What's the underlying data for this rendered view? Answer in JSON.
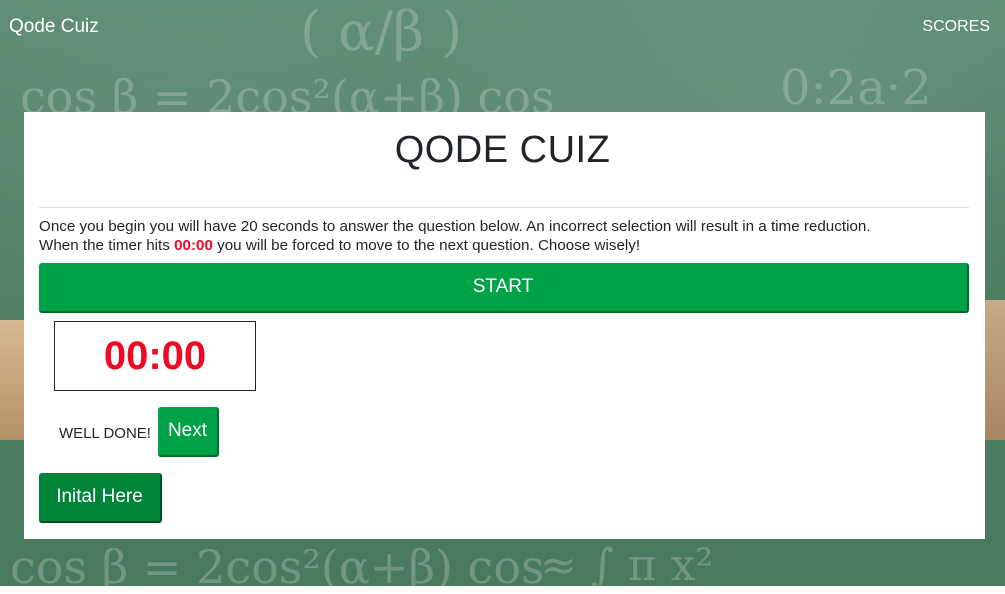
{
  "navbar": {
    "brand": "Qode Cuiz",
    "scores_link": "SCORES"
  },
  "card": {
    "title": "QODE CUIZ",
    "instructions": {
      "line1": "Once you begin you will have 20 seconds to answer the question below. An incorrect selection will result in a time reduction.",
      "line2_before": "When the timer hits ",
      "line2_highlight": "00:00",
      "line2_after": " you will be forced to move to the next question. Choose wisely!"
    },
    "start_button": "START",
    "timer": "00:00",
    "feedback": "WELL DONE!",
    "next_button": "Next",
    "initial_button": "Inital Here"
  },
  "colors": {
    "primary_green": "#00a247",
    "dark_green": "#00843a",
    "timer_red": "#ee0a24"
  }
}
